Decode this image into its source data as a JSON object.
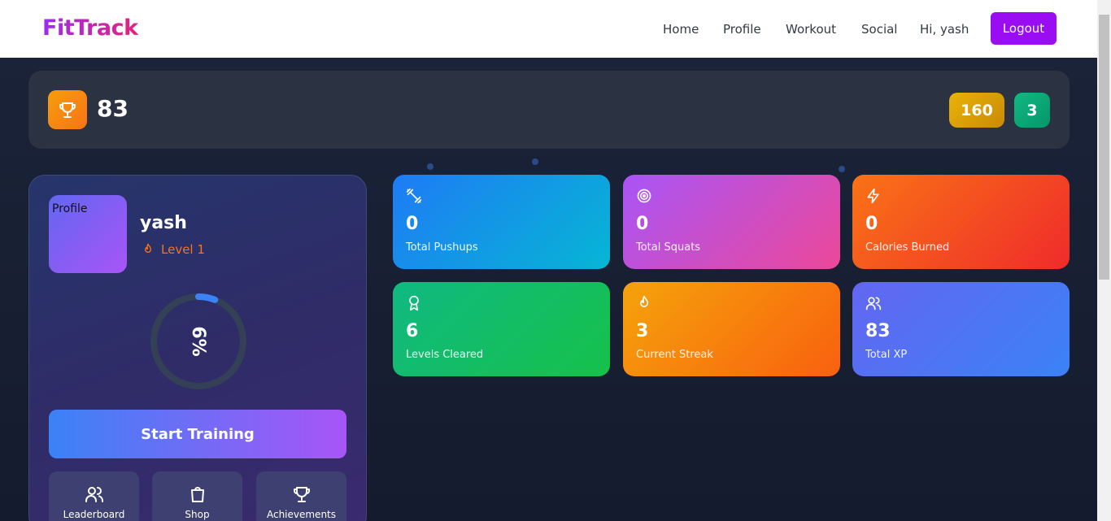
{
  "navbar": {
    "brand": "FitTrack",
    "links": [
      "Home",
      "Profile",
      "Workout",
      "Social"
    ],
    "greeting": "Hi, yash",
    "logout_label": "Logout"
  },
  "topbar": {
    "xp": "83",
    "coins": "160",
    "streak": "3",
    "trophy_icon": "trophy-icon"
  },
  "profile": {
    "avatar_alt": "Profile",
    "username": "yash",
    "level": "Level 1",
    "progress_text": "6%",
    "progress_fraction": 0.06,
    "start_label": "Start Training",
    "quick_actions": [
      {
        "label": "Leaderboard",
        "icon": "users-icon"
      },
      {
        "label": "Shop",
        "icon": "shopping-bag-icon"
      },
      {
        "label": "Achievements",
        "icon": "trophy-icon"
      }
    ]
  },
  "stats": [
    {
      "value": "0",
      "label": "Total Pushups",
      "icon": "dumbbell-icon",
      "colors": [
        "#1e7bf5",
        "#06b6d4"
      ]
    },
    {
      "value": "0",
      "label": "Total Squats",
      "icon": "target-icon",
      "colors": [
        "#a855f7",
        "#ec4899"
      ]
    },
    {
      "value": "0",
      "label": "Calories Burned",
      "icon": "lightning-icon",
      "colors": [
        "#f97316",
        "#ef2b2b"
      ]
    },
    {
      "value": "6",
      "label": "Levels Cleared",
      "icon": "award-icon",
      "colors": [
        "#10b981",
        "#16c14a"
      ]
    },
    {
      "value": "3",
      "label": "Current Streak",
      "icon": "flame-icon",
      "colors": [
        "#f5a30b",
        "#f9600f"
      ]
    },
    {
      "value": "83",
      "label": "Total XP",
      "icon": "users-icon",
      "colors": [
        "#6366f1",
        "#3b82f6"
      ]
    }
  ]
}
